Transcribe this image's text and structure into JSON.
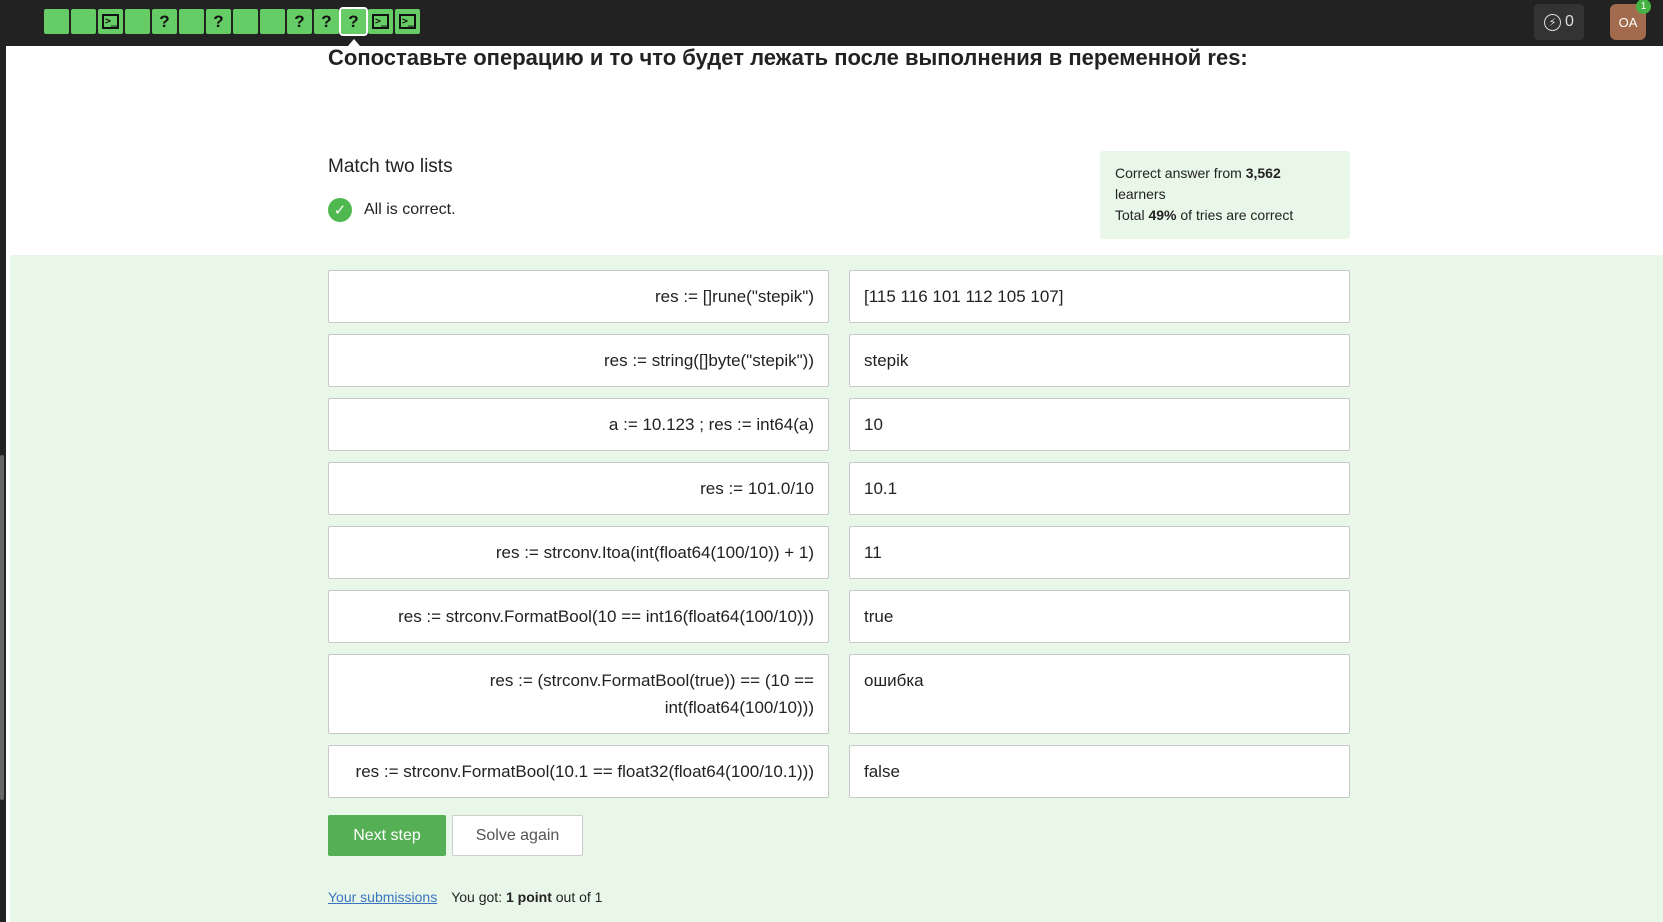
{
  "steps": [
    {
      "type": "done",
      "glyph": ""
    },
    {
      "type": "done",
      "glyph": ""
    },
    {
      "type": "code",
      "glyph": ">_"
    },
    {
      "type": "done",
      "glyph": ""
    },
    {
      "type": "quiz",
      "glyph": "?"
    },
    {
      "type": "done",
      "glyph": ""
    },
    {
      "type": "quiz",
      "glyph": "?"
    },
    {
      "type": "done",
      "glyph": ""
    },
    {
      "type": "done",
      "glyph": ""
    },
    {
      "type": "quiz",
      "glyph": "?"
    },
    {
      "type": "quiz",
      "glyph": "?"
    },
    {
      "type": "quiz-active",
      "glyph": "?"
    },
    {
      "type": "code",
      "glyph": ">_"
    },
    {
      "type": "code",
      "glyph": ">_"
    }
  ],
  "header": {
    "energy_count": "0",
    "avatar_initials": "OA",
    "notification_count": "1"
  },
  "question_text": "Сопоставьте операцию и то что будет лежать после выполнения в переменной res:",
  "task": {
    "title": "Match two lists",
    "status": "All is correct."
  },
  "stats": {
    "line1_prefix": "Correct answer from ",
    "learners": "3,562",
    "line1_suffix": " learners",
    "line2_prefix": "Total ",
    "percent": "49%",
    "line2_suffix": " of tries are correct"
  },
  "pairs": [
    {
      "left": "res := []rune(\"stepik\")",
      "right": "[115 116 101 112 105 107]"
    },
    {
      "left": "res := string([]byte(\"stepik\"))",
      "right": "stepik"
    },
    {
      "left": "a := 10.123 ; res := int64(a)",
      "right": "10"
    },
    {
      "left": "res := 101.0/10",
      "right": "10.1"
    },
    {
      "left": "res := strconv.Itoa(int(float64(100/10)) + 1)",
      "right": "11"
    },
    {
      "left": "res := strconv.FormatBool(10 == int16(float64(100/10)))",
      "right": "true"
    },
    {
      "left": "res := (strconv.FormatBool(true)) == (10 == int(float64(100/10)))",
      "right": "ошибка"
    },
    {
      "left": "res := strconv.FormatBool(10.1 == float32(float64(100/10.1)))",
      "right": "false"
    }
  ],
  "buttons": {
    "next": "Next step",
    "again": "Solve again"
  },
  "footer": {
    "submissions_link": "Your submissions",
    "got_prefix": "You got: ",
    "points": "1 point",
    "got_suffix": " out of 1"
  },
  "colors": {
    "topbar": "#222222",
    "step_done": "#66cc66",
    "accent_green": "#55b055",
    "area_green": "#e9f7e9"
  }
}
